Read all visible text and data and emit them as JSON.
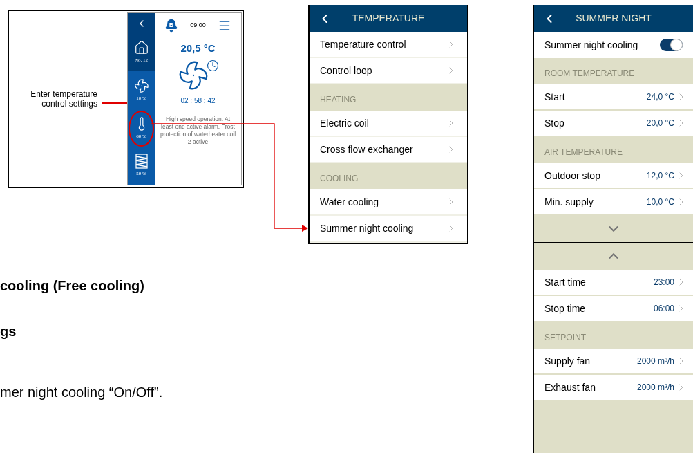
{
  "document": {
    "texts": [
      {
        "kind": "heading",
        "text": "cooling (Free cooling)"
      },
      {
        "kind": "heading",
        "text": "gs"
      },
      {
        "kind": "body",
        "text": "mer night cooling “On/Off”."
      }
    ]
  },
  "home_screen": {
    "callout": "Enter temperature control settings",
    "alarm_badge": "B",
    "time": "09:00",
    "temperature": "20,5 °C",
    "timer": "02 : 58 : 42",
    "status": "High speed operation. At least one active alarm. Frost protection of waterheater coil 2 active",
    "sidebar": [
      {
        "kind": "house",
        "label": "No. 12",
        "selected": true,
        "circled": false
      },
      {
        "kind": "fan",
        "label": "10 %",
        "selected": false,
        "circled": false
      },
      {
        "kind": "thermometer",
        "label": "60 %",
        "selected": false,
        "circled": true
      },
      {
        "kind": "filter",
        "label": "50 %",
        "selected": false,
        "circled": false
      }
    ]
  },
  "temperature_menu": {
    "title": "TEMPERATURE",
    "items": [
      {
        "kind": "item",
        "label": "Temperature control"
      },
      {
        "kind": "item",
        "label": "Control loop"
      },
      {
        "kind": "section",
        "label": "HEATING"
      },
      {
        "kind": "item",
        "label": "Electric coil"
      },
      {
        "kind": "item",
        "label": "Cross flow exchanger"
      },
      {
        "kind": "section",
        "label": "COOLING"
      },
      {
        "kind": "item",
        "label": "Water cooling"
      },
      {
        "kind": "item",
        "label": "Summer night cooling"
      }
    ]
  },
  "summer_night": {
    "title": "SUMMER NIGHT",
    "pages": [
      {
        "items": [
          {
            "kind": "toggle",
            "label": "Summer night cooling",
            "on": true
          },
          {
            "kind": "section",
            "label": "ROOM TEMPERATURE"
          },
          {
            "kind": "value",
            "label": "Start",
            "value": "24,0 °C"
          },
          {
            "kind": "value",
            "label": "Stop",
            "value": "20,0 °C"
          },
          {
            "kind": "section",
            "label": "AIR TEMPERATURE"
          },
          {
            "kind": "value",
            "label": "Outdoor stop",
            "value": "12,0 °C"
          },
          {
            "kind": "value",
            "label": "Min. supply",
            "value": "10,0 °C"
          },
          {
            "kind": "scroll_down"
          }
        ]
      },
      {
        "items": [
          {
            "kind": "scroll_up"
          },
          {
            "kind": "value",
            "label": "Start time",
            "value": "23:00"
          },
          {
            "kind": "value",
            "label": "Stop time",
            "value": "06:00"
          },
          {
            "kind": "section",
            "label": "SETPOINT"
          },
          {
            "kind": "value",
            "label": "Supply fan",
            "value": "2000 m³/h"
          },
          {
            "kind": "value",
            "label": "Exhaust fan",
            "value": "2000 m³/h"
          }
        ]
      }
    ]
  }
}
